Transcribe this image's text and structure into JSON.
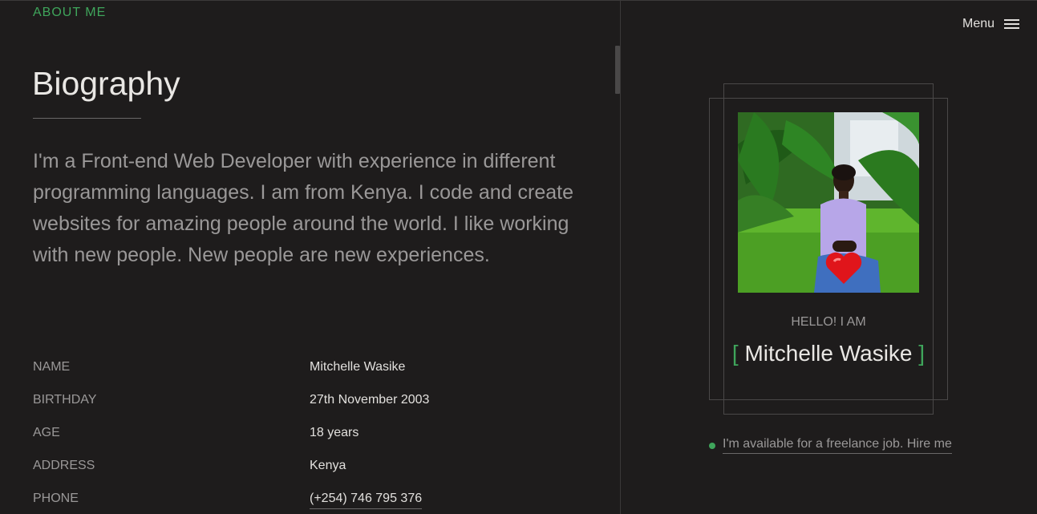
{
  "left": {
    "section_label": "ABOUT ME",
    "title": "Biography",
    "bio": "I'm a Front-end Web Developer with experience in different programming languages. I am from Kenya. I code and create websites for amazing people around the world. I like working with new people. New people are new experiences.",
    "info": [
      {
        "key": "NAME",
        "value": "Mitchelle Wasike"
      },
      {
        "key": "BIRTHDAY",
        "value": "27th November 2003"
      },
      {
        "key": "AGE",
        "value": "18 years"
      },
      {
        "key": "ADDRESS",
        "value": "Kenya"
      },
      {
        "key": "PHONE",
        "value": "(+254) 746 795 376"
      }
    ]
  },
  "right": {
    "menu_label": "Menu",
    "hello": "HELLO! I AM",
    "name": "Mitchelle Wasike",
    "bracket_open": "[",
    "bracket_close": "]",
    "availability": "I'm available for a freelance job. Hire me",
    "photo_overlay": "❤️"
  },
  "colors": {
    "accent": "#3fa55b",
    "background": "#1e1c1c",
    "text_primary": "#e9e7e4",
    "text_muted": "#9a9898"
  },
  "icons": {
    "menu": "hamburger-icon",
    "availability": "status-dot-icon"
  }
}
